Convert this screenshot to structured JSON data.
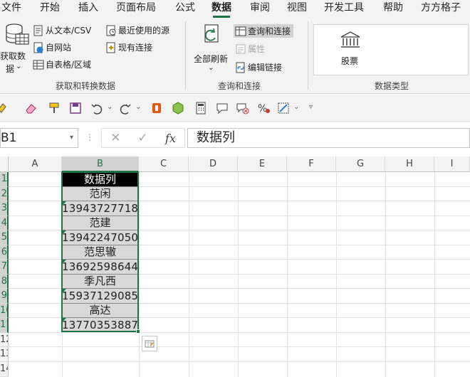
{
  "menu": {
    "tabs": [
      "文件",
      "开始",
      "插入",
      "页面布局",
      "公式",
      "数据",
      "审阅",
      "视图",
      "开发工具",
      "帮助",
      "方方格子"
    ],
    "active_tab": "数据"
  },
  "ribbon": {
    "get_data": {
      "line1": "获取数",
      "line2": "据"
    },
    "from_text_csv": "从文本/CSV",
    "from_web": "自网站",
    "from_table": "自表格/区域",
    "recent_sources": "最近使用的源",
    "existing_connections": "现有连接",
    "group_get_transform": "获取和转换数据",
    "refresh_all": "全部刷新",
    "queries_connections": "查询和连接",
    "properties": "属性",
    "edit_links": "编辑链接",
    "group_queries": "查询和连接",
    "stocks": "股票",
    "group_data_types": "数据类型"
  },
  "formula_bar": {
    "name_box": "B1",
    "fx_label": "fx",
    "formula": "数据列"
  },
  "sheet": {
    "columns": [
      "A",
      "B",
      "C",
      "D",
      "E",
      "F",
      "G",
      "H",
      "I"
    ],
    "selected_column": "B",
    "rows": [
      "1",
      "2",
      "3",
      "4",
      "5",
      "6",
      "7",
      "8",
      "9",
      "10",
      "11",
      "12",
      "13",
      "14"
    ],
    "cells_b": [
      "数据列",
      "范闲",
      "13943727718",
      "范建",
      "13942247050",
      "范思辙",
      "13692598644",
      "季凡西",
      "15937129085",
      "高达",
      "13770353887"
    ]
  },
  "colors": {
    "accent": "#217346",
    "ribbon_bg": "#f3f3f3",
    "cell_fill": "#d9d9d9",
    "header_fill": "#000000"
  }
}
